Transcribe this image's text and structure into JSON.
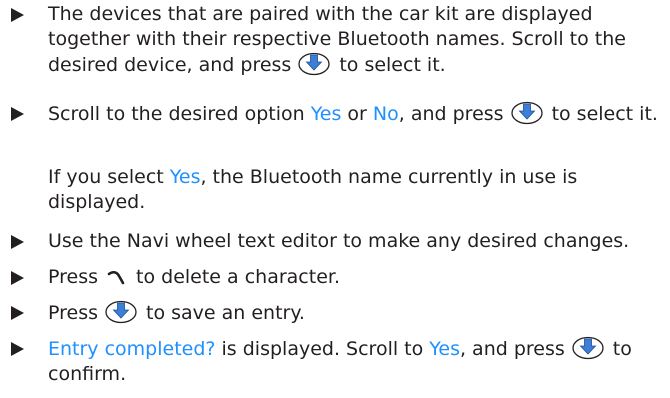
{
  "colors": {
    "text": "#231f20",
    "highlight": "#1e90ff",
    "icon_arrow": "#3d7fd6"
  },
  "icons": {
    "navi_wheel": "navi-wheel-icon",
    "clear_key": "clear-key-icon"
  },
  "items": [
    {
      "t1": "The devices that are paired with the car kit are displayed together with their respective Bluetooth names. Scroll to the desired device, and press",
      "t2": "to select it."
    },
    {
      "t1": "Scroll to the desired option",
      "yes": "Yes",
      "or": "or",
      "no": "No",
      "t2": ", and press",
      "t3": "to select it."
    },
    {
      "note_t1": "If you select",
      "yes": "Yes",
      "note_t2": ", the Bluetooth name currently in use is displayed."
    },
    {
      "t1": "Use the Navi wheel text editor to make any desired changes."
    },
    {
      "t1": "Press",
      "t2": "to delete a character."
    },
    {
      "t1": "Press",
      "t2": "to save an entry."
    },
    {
      "hl": "Entry completed?",
      "t1": "is displayed. Scroll to",
      "yes": "Yes",
      "t2": ", and press",
      "t3": "to confirm."
    }
  ]
}
